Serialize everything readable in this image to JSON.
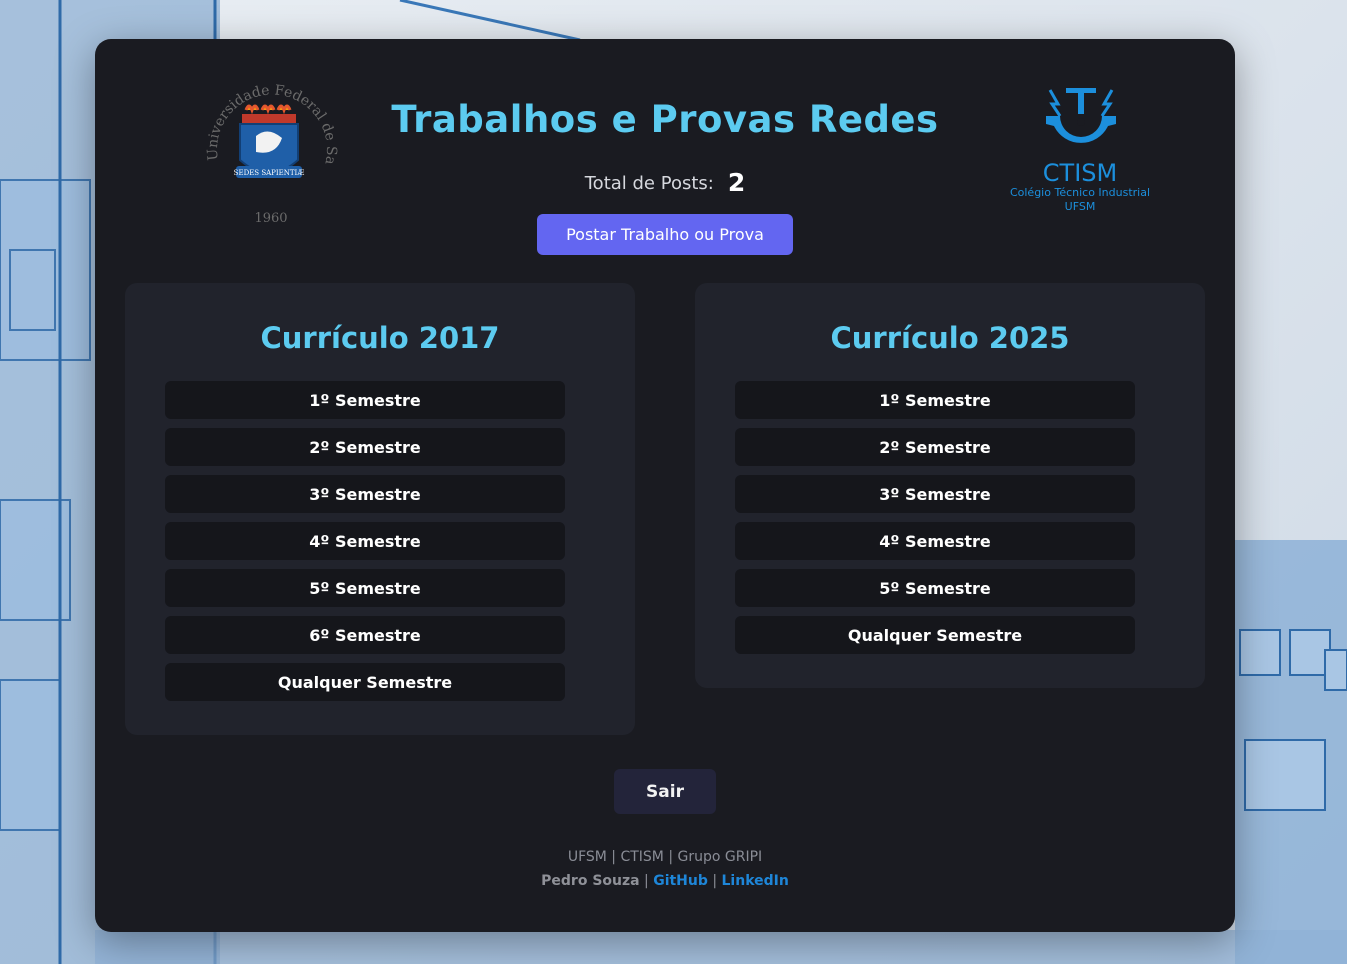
{
  "header": {
    "title": "Trabalhos e Provas Redes",
    "posts_label": "Total de Posts:",
    "posts_count": "2",
    "post_button": "Postar Trabalho ou Prova"
  },
  "logos": {
    "ufsm_ring": "Universidade Federal de Santa Maria",
    "ufsm_motto": "SEDES SAPIENTIÆ",
    "ufsm_year": "1960",
    "ctism_name": "CTISM",
    "ctism_sub": "Colégio Técnico Industrial",
    "ctism_univ": "UFSM"
  },
  "curriculum_2017": {
    "title": "Currículo 2017",
    "items": [
      "1º Semestre",
      "2º Semestre",
      "3º Semestre",
      "4º Semestre",
      "5º Semestre",
      "6º Semestre",
      "Qualquer Semestre"
    ]
  },
  "curriculum_2025": {
    "title": "Currículo 2025",
    "items": [
      "1º Semestre",
      "2º Semestre",
      "3º Semestre",
      "4º Semestre",
      "5º Semestre",
      "Qualquer Semestre"
    ]
  },
  "logout_label": "Sair",
  "footer": {
    "line1": "UFSM | CTISM | Grupo GRIPI",
    "author": "Pedro Souza",
    "sep1": " | ",
    "github": "GitHub",
    "sep2": " | ",
    "linkedin": "LinkedIn"
  },
  "colors": {
    "accent": "#5ccbf0",
    "button": "#6366f1",
    "card": "#1a1b21",
    "panel": "#21232c",
    "link": "#1e86d8"
  }
}
